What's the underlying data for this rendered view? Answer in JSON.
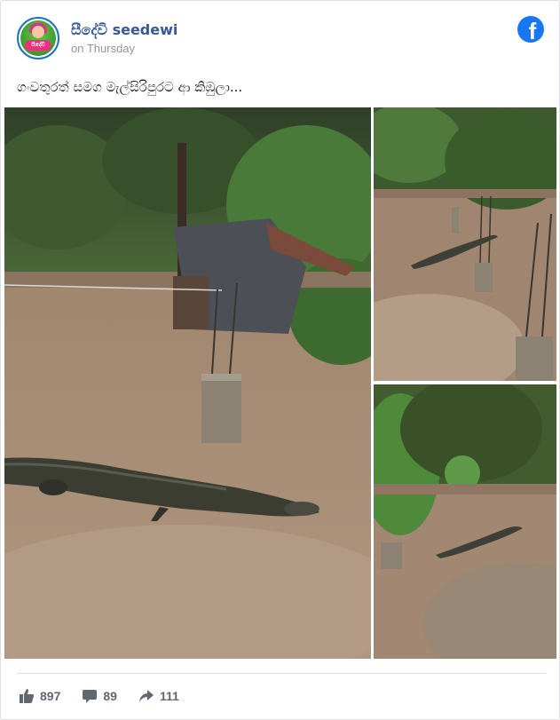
{
  "post": {
    "page_name": "සීදේවි seedewi",
    "time": "on Thursday",
    "text": "ගංවතුරත් සමග මැල්සිරිපුරට ආ කිඹුලා...",
    "platform_icon": "facebook-icon",
    "avatar_text": "සීදේවි"
  },
  "photos": [
    {
      "name": "flood-photo-main",
      "subject": "crocodile in floodwater near shed"
    },
    {
      "name": "flood-photo-top-right",
      "subject": "crocodile near pillars"
    },
    {
      "name": "flood-photo-bottom-right",
      "subject": "crocodile in flooded yard"
    }
  ],
  "stats": {
    "likes": "897",
    "comments": "89",
    "shares": "111",
    "like_icon": "thumbs-up-icon",
    "comment_icon": "comment-icon",
    "share_icon": "share-arrow-icon"
  },
  "colors": {
    "page_name": "#385898",
    "facebook_blue": "#1877f2",
    "meta_text": "#90949c",
    "floodwater": "#a58a72"
  }
}
